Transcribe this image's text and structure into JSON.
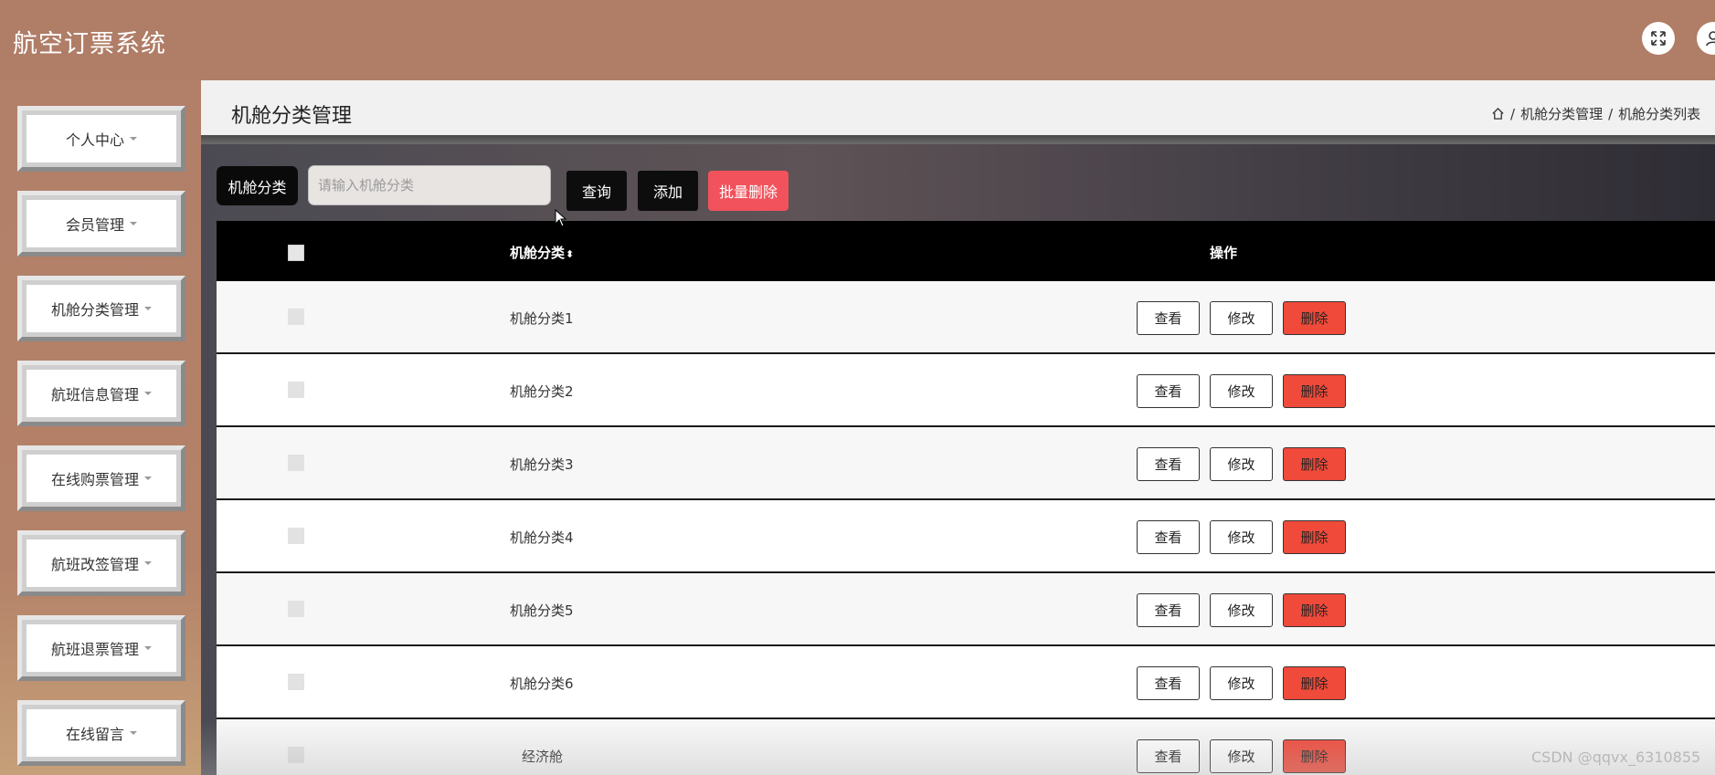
{
  "app": {
    "title": "航空订票系统"
  },
  "header": {
    "icons": [
      "fullscreen-icon",
      "user-icon"
    ]
  },
  "sidebar": {
    "items": [
      {
        "label": "个人中心"
      },
      {
        "label": "会员管理"
      },
      {
        "label": "机舱分类管理"
      },
      {
        "label": "航班信息管理"
      },
      {
        "label": "在线购票管理"
      },
      {
        "label": "航班改签管理"
      },
      {
        "label": "航班退票管理"
      },
      {
        "label": "在线留言"
      }
    ]
  },
  "page": {
    "title": "机舱分类管理",
    "breadcrumb": {
      "sep": "/",
      "level1": "机舱分类管理",
      "level2": "机舱分类列表"
    }
  },
  "search": {
    "label": "机舱分类",
    "placeholder": "请输入机舱分类",
    "value": "",
    "query_label": "查询",
    "add_label": "添加",
    "batch_delete_label": "批量删除"
  },
  "table": {
    "columns": {
      "name": "机舱分类",
      "sort_icon": "⬍",
      "ops": "操作"
    },
    "rows": [
      {
        "name": "机舱分类1"
      },
      {
        "name": "机舱分类2"
      },
      {
        "name": "机舱分类3"
      },
      {
        "name": "机舱分类4"
      },
      {
        "name": "机舱分类5"
      },
      {
        "name": "机舱分类6"
      },
      {
        "name": "经济舱"
      }
    ],
    "row_actions": {
      "view": "查看",
      "edit": "修改",
      "delete": "删除"
    }
  },
  "watermark": "CSDN @qqvx_6310855",
  "colors": {
    "header_bg": "#b07d67",
    "delete": "#f04a3a",
    "batch_delete": "#f1525b",
    "table_header": "#000000"
  }
}
